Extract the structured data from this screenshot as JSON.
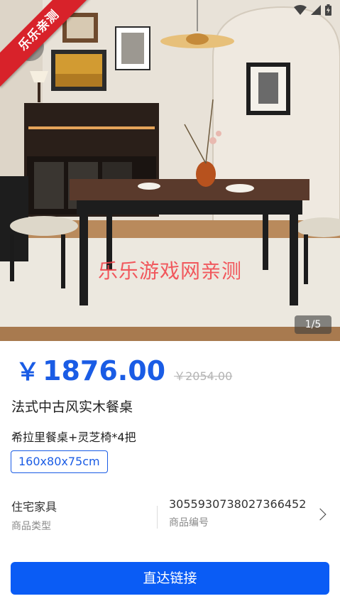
{
  "gallery": {
    "page_indicator": "1/5",
    "watermark_text": "乐乐游戏网亲测",
    "ribbon_text": "乐乐亲测"
  },
  "product": {
    "currency": "￥",
    "price": "1876.00",
    "original_price": "￥2054.00",
    "title": "法式中古风实木餐桌",
    "variant": "希拉里餐桌+灵芝椅*4把",
    "size": "160x80x75cm"
  },
  "meta": {
    "category_value": "住宅家具",
    "category_label": "商品类型",
    "sku_value": "3055930738027366452",
    "sku_label": "商品编号"
  },
  "cta": {
    "label": "直达链接"
  },
  "colors": {
    "accent": "#1a5ce5",
    "button": "#0a5cf5",
    "ribbon": "#d8222a"
  },
  "icons": [
    "wifi-icon",
    "signal-icon",
    "battery-icon",
    "back-arrow-icon",
    "chevron-right-icon"
  ]
}
